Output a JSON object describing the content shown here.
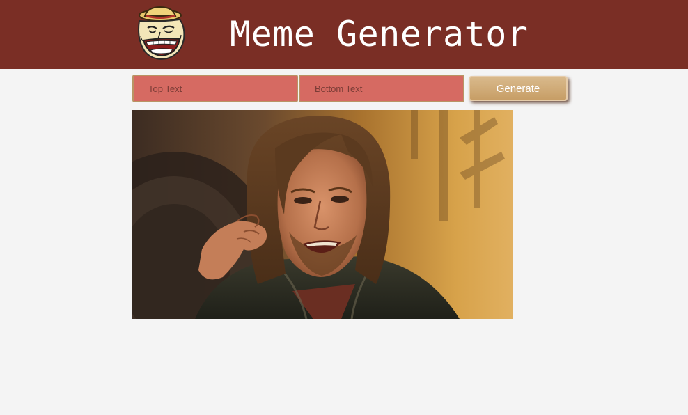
{
  "header": {
    "title": "Meme Generator",
    "logo_icon": "troll-face-icon"
  },
  "form": {
    "top_text_placeholder": "Top Text",
    "top_text_value": "",
    "bottom_text_placeholder": "Bottom Text",
    "bottom_text_value": "",
    "generate_label": "Generate"
  },
  "meme": {
    "image": "meme-image"
  },
  "colors": {
    "header_bg": "#7a2e25",
    "input_bg": "#d66a62",
    "button_bg": "#c79e66",
    "page_bg": "#f4f4f4"
  }
}
